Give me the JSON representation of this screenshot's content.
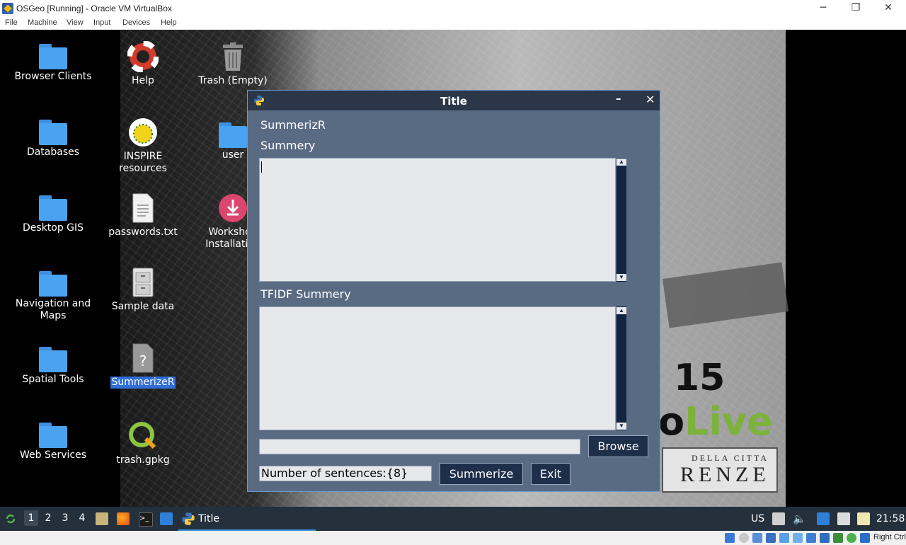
{
  "host": {
    "title": "OSGeo [Running] - Oracle VM VirtualBox",
    "menu": [
      "File",
      "Machine",
      "View",
      "Input",
      "Devices",
      "Help"
    ],
    "win_controls": {
      "minimize": "─",
      "restore": "❐",
      "close": "✕"
    },
    "status_host_key": "Right Ctrl"
  },
  "desktop": {
    "icons": [
      {
        "label": "Browser Clients"
      },
      {
        "label": "Databases"
      },
      {
        "label": "Desktop GIS"
      },
      {
        "label": "Navigation and Maps"
      },
      {
        "label": "Spatial Tools"
      },
      {
        "label": "Web Services"
      },
      {
        "label": "Help"
      },
      {
        "label": "INSPIRE resources"
      },
      {
        "label": "passwords.txt"
      },
      {
        "label": "Sample data"
      },
      {
        "label": "SummerizeR"
      },
      {
        "label": "trash.gpkg"
      },
      {
        "label": "Trash (Empty)"
      },
      {
        "label": "user"
      },
      {
        "label": "Workshop Installation"
      }
    ],
    "wallpaper": {
      "number": "15",
      "live_prefix": "o",
      "live": "Live",
      "plaque_line1": "DELLA CITTA",
      "plaque_line2": "RENZE"
    }
  },
  "app": {
    "window_title": "Title",
    "minimize": "–",
    "close": "✕",
    "heading": "SummerizR",
    "summary_label": "Summery",
    "tfidf_label": "TFIDF Summery",
    "file_path": "",
    "browse_label": "Browse",
    "sentences_value": "Number of sentences:{8}",
    "summerize_label": "Summerize",
    "exit_label": "Exit"
  },
  "taskbar": {
    "workspaces": [
      "1",
      "2",
      "3",
      "4"
    ],
    "active_workspace": "1",
    "task_title": "Title",
    "keyboard_layout": "US",
    "clock": "21:58"
  },
  "colors": {
    "app_bg": "#596b83",
    "app_title_bg": "#2b3648",
    "button_bg": "#1e2f4a",
    "taskbar_bg": "#24303b",
    "selection": "#2f6fd6"
  }
}
